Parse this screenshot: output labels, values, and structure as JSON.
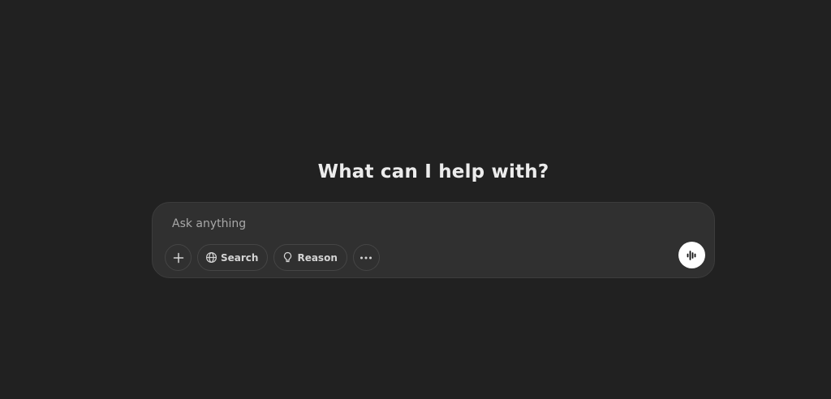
{
  "main": {
    "headline": "What can I help with?"
  },
  "composer": {
    "placeholder": "Ask anything",
    "value": "",
    "buttons": {
      "attach_icon": "plus-icon",
      "search_label": "Search",
      "search_icon": "globe-icon",
      "reason_label": "Reason",
      "reason_icon": "lightbulb-icon",
      "more_icon": "ellipsis-icon",
      "voice_icon": "voice-waveform-icon"
    }
  },
  "colors": {
    "background": "#212121",
    "composer_bg": "#303030",
    "text": "#ececec",
    "placeholder": "#a8a8a8",
    "voice_button": "#ffffff"
  }
}
